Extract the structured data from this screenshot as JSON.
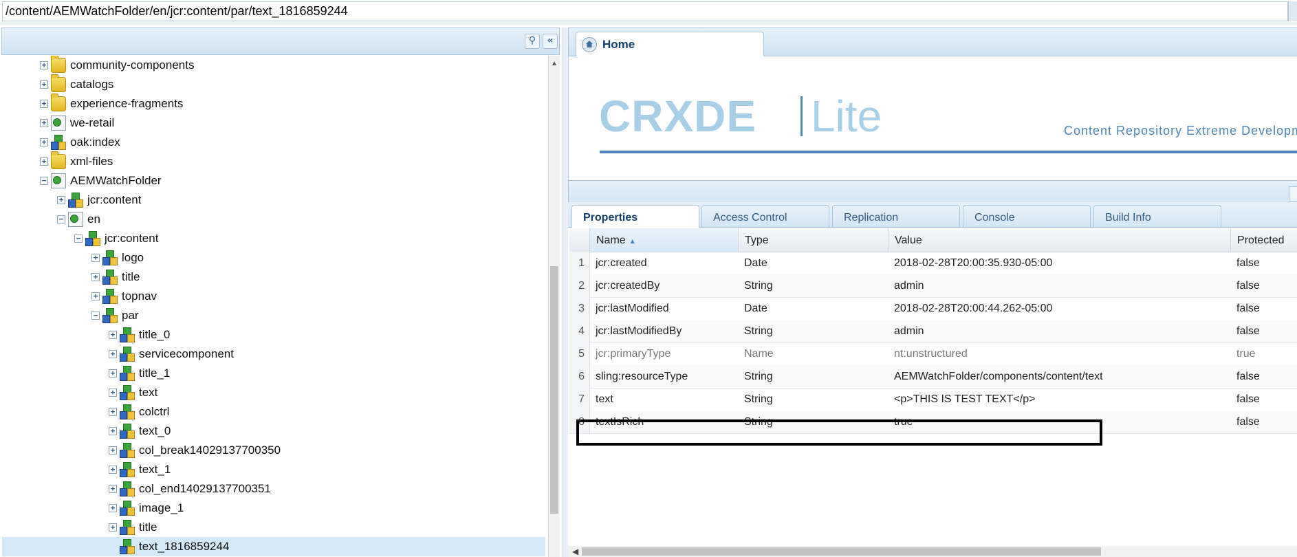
{
  "path": "/content/AEMWatchFolder/en/jcr:content/par/text_1816859244",
  "tree": [
    {
      "label": "community-components",
      "icon": "folder",
      "level": 2,
      "expander": "+"
    },
    {
      "label": "catalogs",
      "icon": "folder",
      "level": 2,
      "expander": "+"
    },
    {
      "label": "experience-fragments",
      "icon": "folder",
      "level": 2,
      "expander": "+"
    },
    {
      "label": "we-retail",
      "icon": "page",
      "level": 2,
      "expander": "+"
    },
    {
      "label": "oak:index",
      "icon": "comp",
      "level": 2,
      "expander": "+"
    },
    {
      "label": "xml-files",
      "icon": "folder",
      "level": 2,
      "expander": "+"
    },
    {
      "label": "AEMWatchFolder",
      "icon": "page",
      "level": 2,
      "expander": "−"
    },
    {
      "label": "jcr:content",
      "icon": "comp",
      "level": 3,
      "expander": "+"
    },
    {
      "label": "en",
      "icon": "page",
      "level": 3,
      "expander": "−"
    },
    {
      "label": "jcr:content",
      "icon": "comp",
      "level": 4,
      "expander": "−"
    },
    {
      "label": "logo",
      "icon": "comp",
      "level": 5,
      "expander": "+"
    },
    {
      "label": "title",
      "icon": "comp",
      "level": 5,
      "expander": "+"
    },
    {
      "label": "topnav",
      "icon": "comp",
      "level": 5,
      "expander": "+"
    },
    {
      "label": "par",
      "icon": "comp",
      "level": 5,
      "expander": "−"
    },
    {
      "label": "title_0",
      "icon": "comp",
      "level": 6,
      "expander": "+"
    },
    {
      "label": "servicecomponent",
      "icon": "comp",
      "level": 6,
      "expander": "+"
    },
    {
      "label": "title_1",
      "icon": "comp",
      "level": 6,
      "expander": "+"
    },
    {
      "label": "text",
      "icon": "comp",
      "level": 6,
      "expander": "+"
    },
    {
      "label": "colctrl",
      "icon": "comp",
      "level": 6,
      "expander": "+"
    },
    {
      "label": "text_0",
      "icon": "comp",
      "level": 6,
      "expander": "+"
    },
    {
      "label": "col_break14029137700350",
      "icon": "comp",
      "level": 6,
      "expander": "+"
    },
    {
      "label": "text_1",
      "icon": "comp",
      "level": 6,
      "expander": "+"
    },
    {
      "label": "col_end14029137700351",
      "icon": "comp",
      "level": 6,
      "expander": "+"
    },
    {
      "label": "image_1",
      "icon": "comp",
      "level": 6,
      "expander": "+"
    },
    {
      "label": "title",
      "icon": "comp",
      "level": 6,
      "expander": "+"
    },
    {
      "label": "text_1816859244",
      "icon": "comp",
      "level": 6,
      "expander": "",
      "selected": true
    }
  ],
  "home_tab": "Home",
  "logo": {
    "crx": "CRXDE",
    "lite": "Lite",
    "tagline": "Content Repository Extreme Developme"
  },
  "tabs": [
    "Properties",
    "Access Control",
    "Replication",
    "Console",
    "Build Info"
  ],
  "columns": [
    "Name",
    "Type",
    "Value",
    "Protected"
  ],
  "rows": [
    {
      "n": "1",
      "name": "jcr:created",
      "type": "Date",
      "value": "2018-02-28T20:00:35.930-05:00",
      "protected": "false"
    },
    {
      "n": "2",
      "name": "jcr:createdBy",
      "type": "String",
      "value": "admin",
      "protected": "false"
    },
    {
      "n": "3",
      "name": "jcr:lastModified",
      "type": "Date",
      "value": "2018-02-28T20:00:44.262-05:00",
      "protected": "false"
    },
    {
      "n": "4",
      "name": "jcr:lastModifiedBy",
      "type": "String",
      "value": "admin",
      "protected": "false"
    },
    {
      "n": "5",
      "name": "jcr:primaryType",
      "type": "Name",
      "value": "nt:unstructured",
      "protected": "true",
      "dim": true
    },
    {
      "n": "6",
      "name": "sling:resourceType",
      "type": "String",
      "value": "AEMWatchFolder/components/content/text",
      "protected": "false"
    },
    {
      "n": "7",
      "name": "text",
      "type": "String",
      "value": "<p>THIS IS TEST TEXT</p>",
      "protected": "false"
    },
    {
      "n": "8",
      "name": "textIsRich",
      "type": "String",
      "value": "true",
      "protected": "false"
    }
  ]
}
